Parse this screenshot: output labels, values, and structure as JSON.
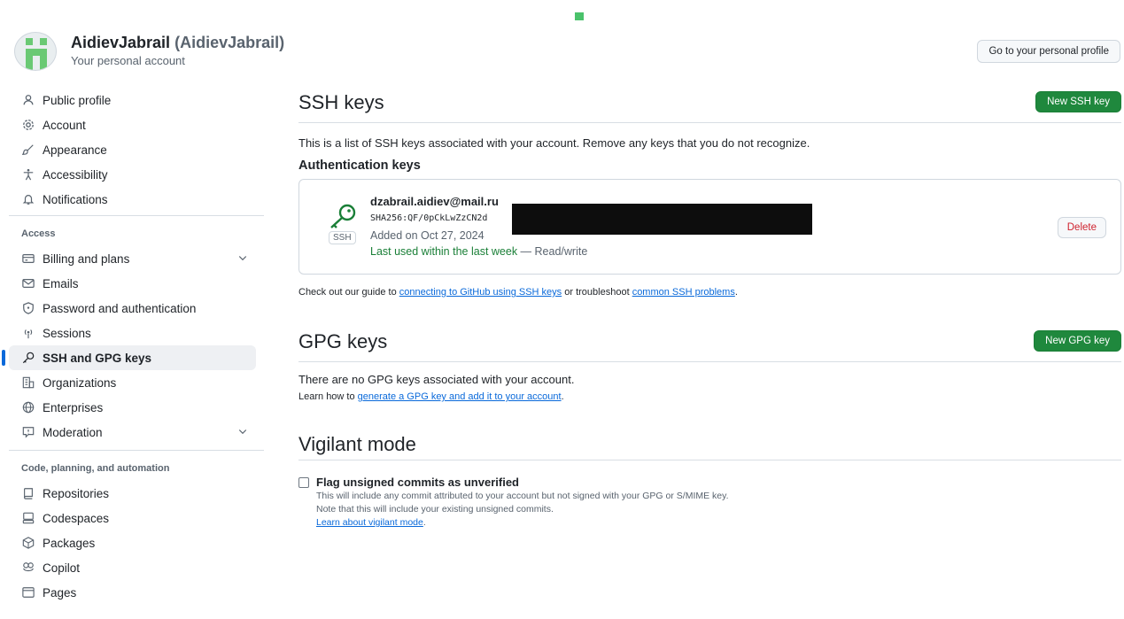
{
  "header": {
    "user_name": "AidievJabrail",
    "user_login": "(AidievJabrail)",
    "subtitle": "Your personal account",
    "profile_button": "Go to your personal profile"
  },
  "sidebar": {
    "items_top": [
      {
        "label": "Public profile",
        "icon": "person-icon"
      },
      {
        "label": "Account",
        "icon": "gear-icon"
      },
      {
        "label": "Appearance",
        "icon": "paintbrush-icon"
      },
      {
        "label": "Accessibility",
        "icon": "accessibility-icon"
      },
      {
        "label": "Notifications",
        "icon": "bell-icon"
      }
    ],
    "group_access": "Access",
    "items_access": [
      {
        "label": "Billing and plans",
        "icon": "credit-card-icon"
      },
      {
        "label": "Emails",
        "icon": "mail-icon"
      },
      {
        "label": "Password and authentication",
        "icon": "shield-lock-icon"
      },
      {
        "label": "Sessions",
        "icon": "broadcast-icon"
      },
      {
        "label": "SSH and GPG keys",
        "icon": "key-icon"
      },
      {
        "label": "Organizations",
        "icon": "organization-icon"
      },
      {
        "label": "Enterprises",
        "icon": "globe-icon"
      },
      {
        "label": "Moderation",
        "icon": "report-icon"
      }
    ],
    "group_code": "Code, planning, and automation",
    "items_code": [
      {
        "label": "Repositories",
        "icon": "repo-icon"
      },
      {
        "label": "Codespaces",
        "icon": "codespaces-icon"
      },
      {
        "label": "Packages",
        "icon": "package-icon"
      },
      {
        "label": "Copilot",
        "icon": "copilot-icon"
      },
      {
        "label": "Pages",
        "icon": "browser-icon"
      }
    ]
  },
  "ssh": {
    "title": "SSH keys",
    "new_button": "New SSH key",
    "intro": "This is a list of SSH keys associated with your account. Remove any keys that you do not recognize.",
    "auth_heading": "Authentication keys",
    "key": {
      "title": "dzabrail.aidiev@mail.ru",
      "fingerprint": "SHA256:QF/0pCkLwZzCN2d",
      "added": "Added on Oct 27, 2024",
      "last_used": "Last used within the last week",
      "access": " — Read/write",
      "type_label": "SSH",
      "delete_button": "Delete"
    },
    "guide_prefix": "Check out our guide to ",
    "guide_link1": "connecting to GitHub using SSH keys",
    "guide_middle": " or troubleshoot ",
    "guide_link2": "common SSH problems",
    "guide_suffix": "."
  },
  "gpg": {
    "title": "GPG keys",
    "new_button": "New GPG key",
    "empty": "There are no GPG keys associated with your account.",
    "learn_prefix": "Learn how to ",
    "learn_link": "generate a GPG key and add it to your account",
    "learn_suffix": "."
  },
  "vigilant": {
    "title": "Vigilant mode",
    "checkbox_label": "Flag unsigned commits as unverified",
    "note1": "This will include any commit attributed to your account but not signed with your GPG or S/MIME key.",
    "note2": "Note that this will include your existing unsigned commits.",
    "learn_link": "Learn about vigilant mode",
    "learn_suffix": "."
  },
  "colors": {
    "accent": "#0969da",
    "success": "#1f883d",
    "danger": "#cf222e"
  }
}
